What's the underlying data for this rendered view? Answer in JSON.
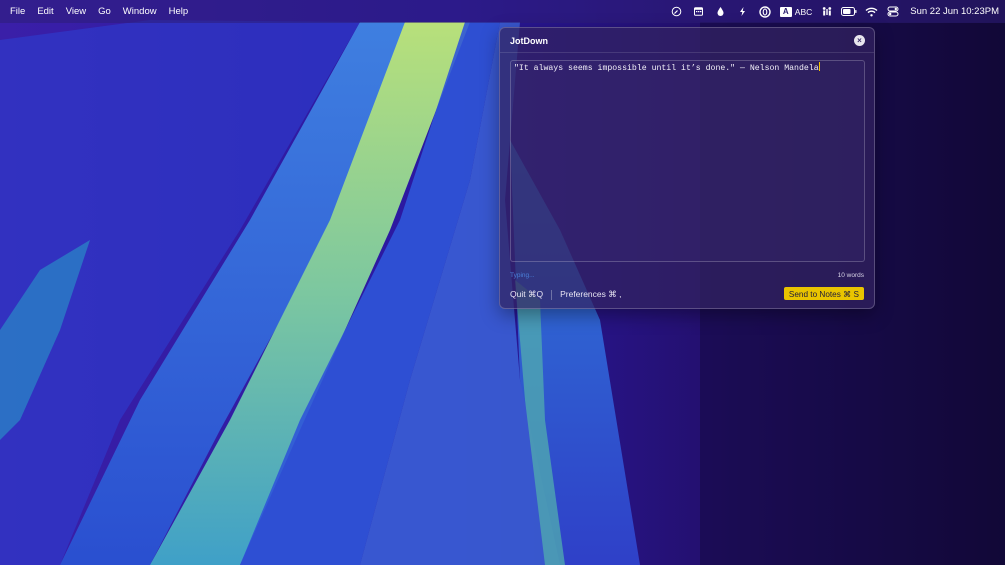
{
  "menubar": {
    "items": [
      "File",
      "Edit",
      "View",
      "Go",
      "Window",
      "Help"
    ],
    "status_icons": [
      "compass-icon",
      "calendar-icon",
      "drop-icon",
      "bolt-icon",
      "circle-icon"
    ],
    "input_badge": "A",
    "input_label": "ABC",
    "datetime": "Sun 22 Jun  10:23PM"
  },
  "popup": {
    "title": "JotDown",
    "text": "\"It always seems impossible until it’s done.\" — Nelson Mandela",
    "typing_status": "Typing...",
    "word_count": "10 words",
    "quit_label": "Quit ⌘Q",
    "prefs_label": "Preferences ⌘ ,",
    "send_label": "Send to Notes ⌘ S",
    "close_glyph": "×"
  },
  "colors": {
    "accent": "#e9c400",
    "typing": "#4a7fd8"
  }
}
